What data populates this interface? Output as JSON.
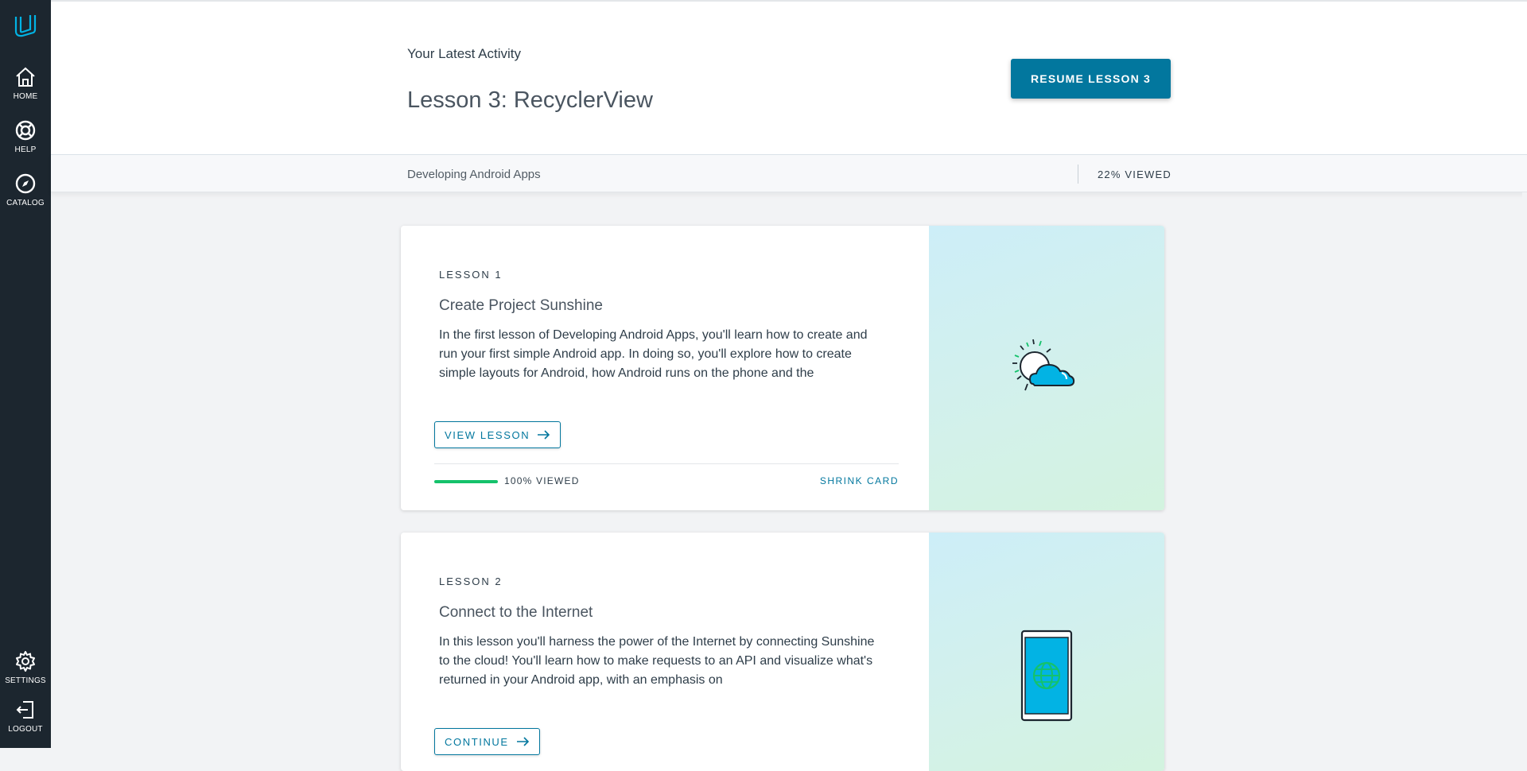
{
  "sidebar": {
    "logo_icon": "udacity-logo",
    "items_top": [
      {
        "label": "HOME",
        "icon": "home-icon"
      },
      {
        "label": "HELP",
        "icon": "lifebuoy-icon"
      },
      {
        "label": "CATALOG",
        "icon": "compass-icon"
      }
    ],
    "items_bottom": [
      {
        "label": "SETTINGS",
        "icon": "gear-icon"
      },
      {
        "label": "LOGOUT",
        "icon": "logout-icon"
      }
    ]
  },
  "header": {
    "latest_label": "Your Latest Activity",
    "lesson_title": "Lesson 3: RecyclerView",
    "resume_label": "RESUME LESSON 3"
  },
  "subheader": {
    "course_name": "Developing Android Apps",
    "viewed": "22% VIEWED"
  },
  "cards": [
    {
      "lesson_num": "LESSON 1",
      "title": "Create Project Sunshine",
      "description": "In the first lesson of Developing Android Apps, you'll learn how to create and run your first simple Android app. In doing so, you'll explore how to create simple layouts for Android, how Android runs on the phone and the",
      "button_label": "VIEW LESSON",
      "progress_label": "100% VIEWED",
      "progress": 1.0,
      "shrink_label": "SHRINK CARD",
      "art_icon": "weather-sun-cloud-icon"
    },
    {
      "lesson_num": "LESSON 2",
      "title": "Connect to the Internet",
      "description": "In this lesson you'll harness the power of the Internet by connecting Sunshine to the cloud! You'll learn how to make requests to an API and visualize what's returned in your Android app, with an emphasis on",
      "button_label": "CONTINUE",
      "art_icon": "phone-globe-icon"
    }
  ],
  "colors": {
    "sidebar_bg": "#1c262f",
    "accent": "#02779e",
    "logo": "#02b3e4",
    "progress": "#15c26b"
  }
}
